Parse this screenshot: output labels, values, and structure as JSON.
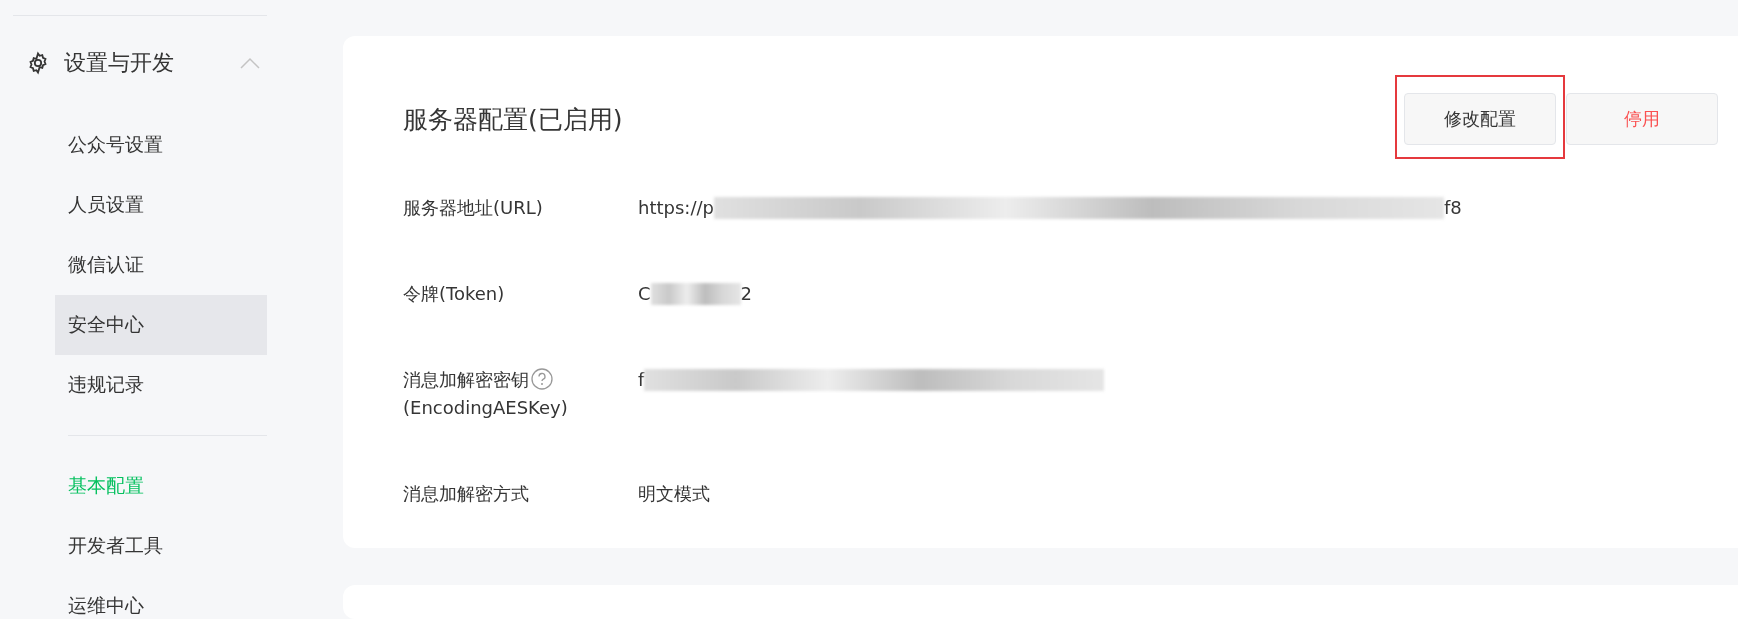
{
  "sidebar": {
    "group": {
      "label": "设置与开发",
      "expanded": true
    },
    "items": [
      {
        "label": "公众号设置",
        "selected": false,
        "hovered": false
      },
      {
        "label": "人员设置",
        "selected": false,
        "hovered": false
      },
      {
        "label": "微信认证",
        "selected": false,
        "hovered": false
      },
      {
        "label": "安全中心",
        "selected": false,
        "hovered": true
      },
      {
        "label": "违规记录",
        "selected": false,
        "hovered": false
      }
    ],
    "items_2": [
      {
        "label": "基本配置",
        "selected": true,
        "hovered": false
      },
      {
        "label": "开发者工具",
        "selected": false,
        "hovered": false
      },
      {
        "label": "运维中心",
        "selected": false,
        "hovered": false
      }
    ]
  },
  "card": {
    "title": "服务器配置(已启用)",
    "buttons": [
      {
        "label": "修改配置",
        "kind": "normal",
        "highlighted": true
      },
      {
        "label": "停用",
        "kind": "danger",
        "highlighted": false
      }
    ],
    "fields": [
      {
        "label": "服务器地址(URL)",
        "value_start": "https://p",
        "value_end": "f8",
        "redacted": true,
        "help": false
      },
      {
        "label": "令牌(Token)",
        "value_start": "C",
        "value_end": "2",
        "redacted": true,
        "help": false
      },
      {
        "label": "消息加解密密钥",
        "label_2": "(EncodingAESKey)",
        "value_start": "f",
        "redacted": true,
        "help": true
      },
      {
        "label": "消息加解密方式",
        "value_start": "明文模式",
        "redacted": false,
        "help": false
      }
    ]
  }
}
